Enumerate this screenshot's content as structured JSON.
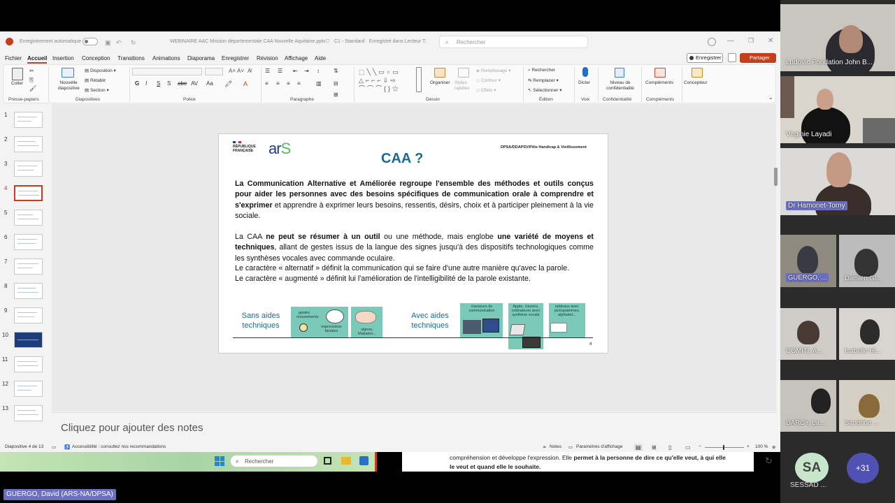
{
  "titlebar": {
    "autosave": "Enregistrement automatique",
    "filename": "WEBINAIRE AAC Mission départementale CAA Nouvelle Aquitaine.pptx",
    "classification": "C1 - Standard  ·  Enregistré dans Lecteur T:",
    "search_placeholder": "Rechercher"
  },
  "menu": [
    "Fichier",
    "Accueil",
    "Insertion",
    "Conception",
    "Transitions",
    "Animations",
    "Diaporama",
    "Enregistrer",
    "Révision",
    "Affichage",
    "Aide"
  ],
  "buttons": {
    "record": "Enregistrer",
    "share": "Partager"
  },
  "ribbon": {
    "paste": "Coller",
    "new_slide": "Nouvelle diapositive",
    "layout": "Disposition",
    "reset": "Rétablir",
    "section": "Section",
    "arrange": "Organiser",
    "quick_styles": "Styles rapides",
    "fill": "Remplissage",
    "outline": "Contour",
    "effects": "Effets",
    "find": "Rechercher",
    "replace": "Remplacer",
    "select": "Sélectionner",
    "dictate": "Dicter",
    "sensitivity": "Niveau de confidentialité",
    "addins": "Compléments",
    "designer": "Concepteur",
    "groups": [
      "Presse-papiers",
      "Diapositives",
      "Police",
      "Paragraphe",
      "Dessin",
      "Édition",
      "Voix",
      "Confidentialité",
      "Compléments"
    ]
  },
  "thumbnails": [
    "1",
    "2",
    "3",
    "4",
    "5",
    "6",
    "7",
    "8",
    "9",
    "10",
    "11",
    "12",
    "13"
  ],
  "slide": {
    "rf_line1": "RÉPUBLIQUE",
    "rf_line2": "FRANÇAISE",
    "ars_a": "ar",
    "ars_s": "S",
    "dept": "DPSA/DDAPSV/Pôle Handicap & Vieillissement",
    "title": "CAA ?",
    "p1_bold": "La Communication Alternative et Améliorée regroupe l'ensemble des méthodes et outils conçus pour aider les personnes avec des besoins spécifiques de communication orale à comprendre et s'exprimer",
    "p1_rest": " et apprendre à exprimer leurs besoins, ressentis, désirs, choix et à participer pleinement à la vie sociale.",
    "p2_a": "La CAA ",
    "p2_b": "ne peut se résumer à un outil",
    "p2_c": " ou une méthode, mais englobe ",
    "p2_d": "une variété de moyens et techniques",
    "p2_e": ", allant de gestes issus de la langue des signes jusqu'à des dispositifs technologiques comme les synthèses vocales avec commande oculaire.",
    "p3": "Le caractère « alternatif » définit la communication qui se faire d'une autre manière qu'avec la parole.",
    "p4": "Le caractère « augmenté » définit lui l'amélioration de l'intelligibilité de la parole existante.",
    "label_without": "Sans aides techniques",
    "label_with": "Avec aides techniques",
    "tiles": [
      "gestes mouvements",
      "expressions faciales",
      "signes, Makaton...",
      "classeurs de communication",
      "Apple, claviers, ordinateurs avec synthèse vocale",
      "tableaux avec pictogrammes, alphabet..."
    ],
    "page_number": "4"
  },
  "notes_placeholder": "Cliquez pour ajouter des notes",
  "status": {
    "slide_counter": "Diapositive 4 de 13",
    "accessibility": "Accessibilité : consultez nos recommandations",
    "notes": "Notes",
    "display_settings": "Paramètres d'affichage",
    "zoom": "100 %"
  },
  "taskbar": {
    "search": "Rechercher"
  },
  "doc_snippet": {
    "line1_a": "compréhension et développe l'expression. Elle ",
    "line1_b": "permet à la personne de dire ce qu'elle veut, à qui elle",
    "line2": "le veut et quand elle le souhaite."
  },
  "presenter": "GUERGO, David (ARS-NA/DPSA)",
  "participants": [
    {
      "name": "Ludovic Fondation John B..."
    },
    {
      "name": "Virginie Layadi"
    },
    {
      "name": "Dr Hamonet-Torny"
    },
    {
      "name": "GUERGO, ..."
    },
    {
      "name": "Damien Gl..."
    },
    {
      "name": "COMITI, A..."
    },
    {
      "name": "Isabelle Hl..."
    },
    {
      "name": "DARCY, La..."
    },
    {
      "name": "Sandrine ..."
    }
  ],
  "avatar": {
    "initials": "SA",
    "label": "SESSAD ..."
  },
  "more_participants": "+31"
}
